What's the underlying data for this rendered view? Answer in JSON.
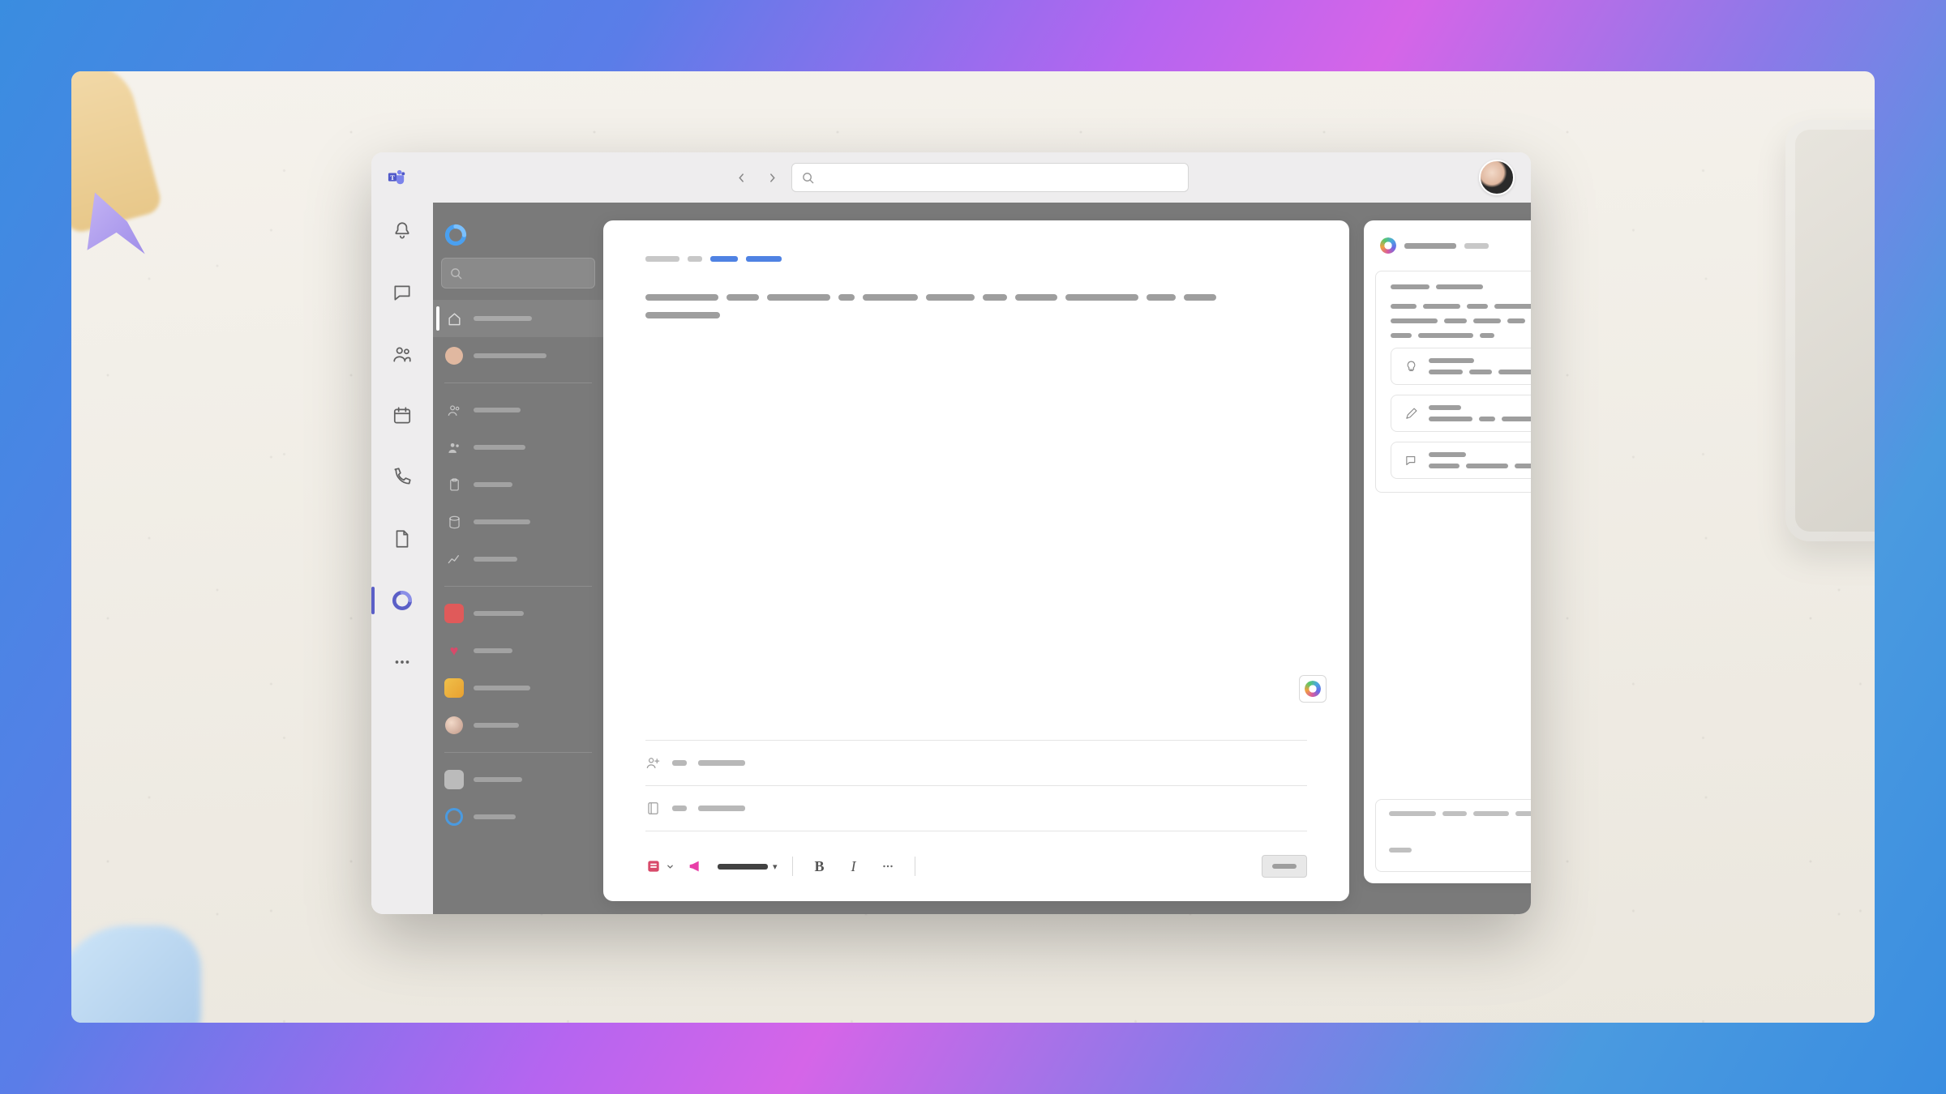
{
  "titlebar": {
    "search_placeholder": "",
    "search_value": ""
  },
  "rail": {
    "items": [
      {
        "name": "activity",
        "icon": "bell"
      },
      {
        "name": "chat",
        "icon": "chat"
      },
      {
        "name": "teams",
        "icon": "teams"
      },
      {
        "name": "calendar",
        "icon": "calendar"
      },
      {
        "name": "calls",
        "icon": "phone"
      },
      {
        "name": "files",
        "icon": "file"
      },
      {
        "name": "loop",
        "icon": "loop",
        "active": true
      },
      {
        "name": "more",
        "icon": "dots"
      }
    ]
  },
  "sidebar": {
    "search_placeholder": "",
    "nav": [
      {
        "name": "home",
        "icon": "home",
        "selected": true
      },
      {
        "name": "recent-person",
        "icon": "avatar"
      },
      {
        "name": "shared",
        "icon": "people-outline"
      },
      {
        "name": "people",
        "icon": "people-solid"
      },
      {
        "name": "tasks",
        "icon": "clipboard"
      },
      {
        "name": "data",
        "icon": "database"
      },
      {
        "name": "trends",
        "icon": "trend"
      }
    ],
    "pinned": [
      {
        "name": "item-a",
        "color": "#e05a5a"
      },
      {
        "name": "item-b",
        "color": "#d84a6a"
      },
      {
        "name": "item-c",
        "color": "#f0c04a"
      },
      {
        "name": "item-d",
        "avatar": true
      },
      {
        "name": "item-e",
        "color": "#cccccc"
      },
      {
        "name": "item-f",
        "color": "#4a9ae0",
        "circle": true
      }
    ]
  },
  "page": {
    "breadcrumb": [
      "",
      "",
      ""
    ],
    "content": "",
    "attendees_label": "",
    "notes_label": ""
  },
  "toolbar": {
    "insert_label": "",
    "component_label": "",
    "font_label": "",
    "bold": "B",
    "italic": "I",
    "publish_label": ""
  },
  "copilot": {
    "title": "",
    "subtitle": "",
    "refresh_label": "",
    "input_placeholder": "",
    "suggestions": [
      {
        "icon": "bulb",
        "title": "",
        "body": ""
      },
      {
        "icon": "pencil",
        "title": "",
        "body": ""
      },
      {
        "icon": "chat",
        "title": "",
        "body": ""
      }
    ]
  }
}
